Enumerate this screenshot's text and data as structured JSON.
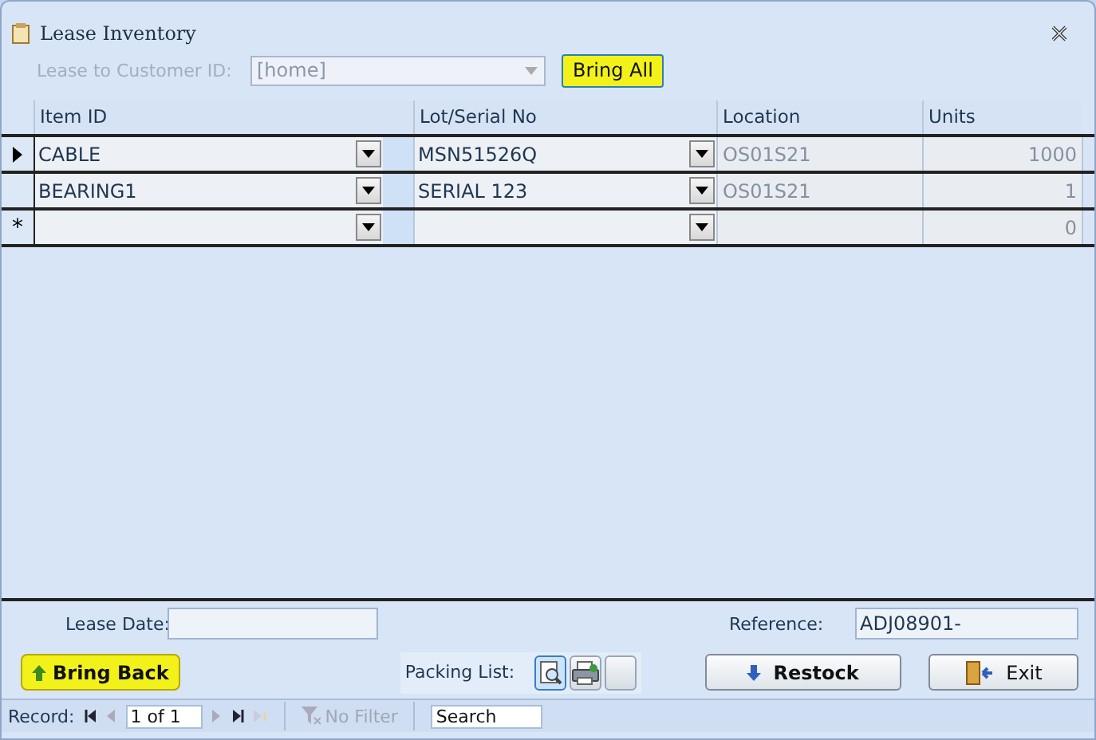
{
  "window": {
    "title": "Lease Inventory"
  },
  "customer": {
    "label": "Lease to Customer ID:",
    "value": "[home]",
    "disabled": true
  },
  "bring_all_button": "Bring All",
  "table": {
    "columns": [
      "Item ID",
      "Lot/Serial No",
      "Location",
      "Units"
    ],
    "rows": [
      {
        "current": true,
        "item_id": "CABLE",
        "lot": "MSN51526Q",
        "location": "OS01S21",
        "units": "1000"
      },
      {
        "current": false,
        "item_id": "BEARING1",
        "lot": "SERIAL 123",
        "location": "OS01S21",
        "units": "1"
      },
      {
        "current": false,
        "new_record_mark": "*",
        "item_id": "",
        "lot": "",
        "location": "",
        "units": "0"
      }
    ]
  },
  "lease_date": {
    "label": "Lease Date:"
  },
  "reference": {
    "label": "Reference:",
    "value": "ADJ08901-"
  },
  "bring_back_button": "Bring Back",
  "packing_list": {
    "label": "Packing List:"
  },
  "restock_button": "Restock",
  "exit_button": "Exit",
  "status_bar": {
    "record_label": "Record:",
    "record_value": "1 of 1",
    "filter": "No Filter",
    "search_placeholder": "Search"
  }
}
